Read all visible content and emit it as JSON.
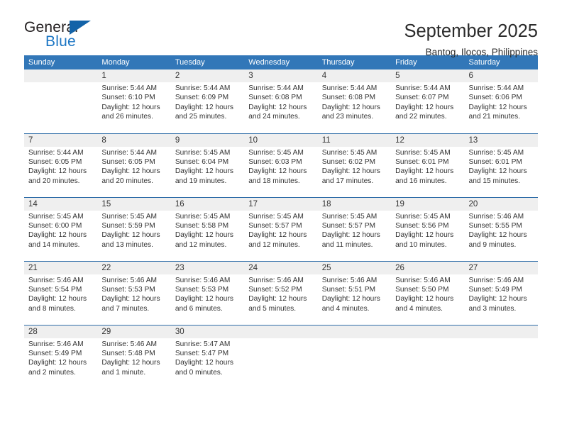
{
  "brand": {
    "name_top": "General",
    "name_bottom": "Blue",
    "triangle_color": "#1363a8",
    "blue_color": "#1c76c4"
  },
  "header": {
    "title": "September 2025",
    "subtitle": "Bantog, Ilocos, Philippines"
  },
  "theme": {
    "header_bg": "#3277b8",
    "row_divider": "#2f6da8",
    "daynum_bg": "#efefef"
  },
  "weekdays": [
    "Sunday",
    "Monday",
    "Tuesday",
    "Wednesday",
    "Thursday",
    "Friday",
    "Saturday"
  ],
  "labels": {
    "sunrise_prefix": "Sunrise:",
    "sunset_prefix": "Sunset:",
    "daylight_prefix": "Daylight:"
  },
  "weeks": [
    [
      {
        "day": "",
        "empty": true
      },
      {
        "day": "1",
        "sunrise": "Sunrise: 5:44 AM",
        "sunset": "Sunset: 6:10 PM",
        "daylight_1": "Daylight: 12 hours",
        "daylight_2": "and 26 minutes."
      },
      {
        "day": "2",
        "sunrise": "Sunrise: 5:44 AM",
        "sunset": "Sunset: 6:09 PM",
        "daylight_1": "Daylight: 12 hours",
        "daylight_2": "and 25 minutes."
      },
      {
        "day": "3",
        "sunrise": "Sunrise: 5:44 AM",
        "sunset": "Sunset: 6:08 PM",
        "daylight_1": "Daylight: 12 hours",
        "daylight_2": "and 24 minutes."
      },
      {
        "day": "4",
        "sunrise": "Sunrise: 5:44 AM",
        "sunset": "Sunset: 6:08 PM",
        "daylight_1": "Daylight: 12 hours",
        "daylight_2": "and 23 minutes."
      },
      {
        "day": "5",
        "sunrise": "Sunrise: 5:44 AM",
        "sunset": "Sunset: 6:07 PM",
        "daylight_1": "Daylight: 12 hours",
        "daylight_2": "and 22 minutes."
      },
      {
        "day": "6",
        "sunrise": "Sunrise: 5:44 AM",
        "sunset": "Sunset: 6:06 PM",
        "daylight_1": "Daylight: 12 hours",
        "daylight_2": "and 21 minutes."
      }
    ],
    [
      {
        "day": "7",
        "sunrise": "Sunrise: 5:44 AM",
        "sunset": "Sunset: 6:05 PM",
        "daylight_1": "Daylight: 12 hours",
        "daylight_2": "and 20 minutes."
      },
      {
        "day": "8",
        "sunrise": "Sunrise: 5:44 AM",
        "sunset": "Sunset: 6:05 PM",
        "daylight_1": "Daylight: 12 hours",
        "daylight_2": "and 20 minutes."
      },
      {
        "day": "9",
        "sunrise": "Sunrise: 5:45 AM",
        "sunset": "Sunset: 6:04 PM",
        "daylight_1": "Daylight: 12 hours",
        "daylight_2": "and 19 minutes."
      },
      {
        "day": "10",
        "sunrise": "Sunrise: 5:45 AM",
        "sunset": "Sunset: 6:03 PM",
        "daylight_1": "Daylight: 12 hours",
        "daylight_2": "and 18 minutes."
      },
      {
        "day": "11",
        "sunrise": "Sunrise: 5:45 AM",
        "sunset": "Sunset: 6:02 PM",
        "daylight_1": "Daylight: 12 hours",
        "daylight_2": "and 17 minutes."
      },
      {
        "day": "12",
        "sunrise": "Sunrise: 5:45 AM",
        "sunset": "Sunset: 6:01 PM",
        "daylight_1": "Daylight: 12 hours",
        "daylight_2": "and 16 minutes."
      },
      {
        "day": "13",
        "sunrise": "Sunrise: 5:45 AM",
        "sunset": "Sunset: 6:01 PM",
        "daylight_1": "Daylight: 12 hours",
        "daylight_2": "and 15 minutes."
      }
    ],
    [
      {
        "day": "14",
        "sunrise": "Sunrise: 5:45 AM",
        "sunset": "Sunset: 6:00 PM",
        "daylight_1": "Daylight: 12 hours",
        "daylight_2": "and 14 minutes."
      },
      {
        "day": "15",
        "sunrise": "Sunrise: 5:45 AM",
        "sunset": "Sunset: 5:59 PM",
        "daylight_1": "Daylight: 12 hours",
        "daylight_2": "and 13 minutes."
      },
      {
        "day": "16",
        "sunrise": "Sunrise: 5:45 AM",
        "sunset": "Sunset: 5:58 PM",
        "daylight_1": "Daylight: 12 hours",
        "daylight_2": "and 12 minutes."
      },
      {
        "day": "17",
        "sunrise": "Sunrise: 5:45 AM",
        "sunset": "Sunset: 5:57 PM",
        "daylight_1": "Daylight: 12 hours",
        "daylight_2": "and 12 minutes."
      },
      {
        "day": "18",
        "sunrise": "Sunrise: 5:45 AM",
        "sunset": "Sunset: 5:57 PM",
        "daylight_1": "Daylight: 12 hours",
        "daylight_2": "and 11 minutes."
      },
      {
        "day": "19",
        "sunrise": "Sunrise: 5:45 AM",
        "sunset": "Sunset: 5:56 PM",
        "daylight_1": "Daylight: 12 hours",
        "daylight_2": "and 10 minutes."
      },
      {
        "day": "20",
        "sunrise": "Sunrise: 5:46 AM",
        "sunset": "Sunset: 5:55 PM",
        "daylight_1": "Daylight: 12 hours",
        "daylight_2": "and 9 minutes."
      }
    ],
    [
      {
        "day": "21",
        "sunrise": "Sunrise: 5:46 AM",
        "sunset": "Sunset: 5:54 PM",
        "daylight_1": "Daylight: 12 hours",
        "daylight_2": "and 8 minutes."
      },
      {
        "day": "22",
        "sunrise": "Sunrise: 5:46 AM",
        "sunset": "Sunset: 5:53 PM",
        "daylight_1": "Daylight: 12 hours",
        "daylight_2": "and 7 minutes."
      },
      {
        "day": "23",
        "sunrise": "Sunrise: 5:46 AM",
        "sunset": "Sunset: 5:53 PM",
        "daylight_1": "Daylight: 12 hours",
        "daylight_2": "and 6 minutes."
      },
      {
        "day": "24",
        "sunrise": "Sunrise: 5:46 AM",
        "sunset": "Sunset: 5:52 PM",
        "daylight_1": "Daylight: 12 hours",
        "daylight_2": "and 5 minutes."
      },
      {
        "day": "25",
        "sunrise": "Sunrise: 5:46 AM",
        "sunset": "Sunset: 5:51 PM",
        "daylight_1": "Daylight: 12 hours",
        "daylight_2": "and 4 minutes."
      },
      {
        "day": "26",
        "sunrise": "Sunrise: 5:46 AM",
        "sunset": "Sunset: 5:50 PM",
        "daylight_1": "Daylight: 12 hours",
        "daylight_2": "and 4 minutes."
      },
      {
        "day": "27",
        "sunrise": "Sunrise: 5:46 AM",
        "sunset": "Sunset: 5:49 PM",
        "daylight_1": "Daylight: 12 hours",
        "daylight_2": "and 3 minutes."
      }
    ],
    [
      {
        "day": "28",
        "sunrise": "Sunrise: 5:46 AM",
        "sunset": "Sunset: 5:49 PM",
        "daylight_1": "Daylight: 12 hours",
        "daylight_2": "and 2 minutes."
      },
      {
        "day": "29",
        "sunrise": "Sunrise: 5:46 AM",
        "sunset": "Sunset: 5:48 PM",
        "daylight_1": "Daylight: 12 hours",
        "daylight_2": "and 1 minute."
      },
      {
        "day": "30",
        "sunrise": "Sunrise: 5:47 AM",
        "sunset": "Sunset: 5:47 PM",
        "daylight_1": "Daylight: 12 hours",
        "daylight_2": "and 0 minutes."
      },
      {
        "day": "",
        "empty": true
      },
      {
        "day": "",
        "empty": true
      },
      {
        "day": "",
        "empty": true
      },
      {
        "day": "",
        "empty": true
      }
    ]
  ]
}
